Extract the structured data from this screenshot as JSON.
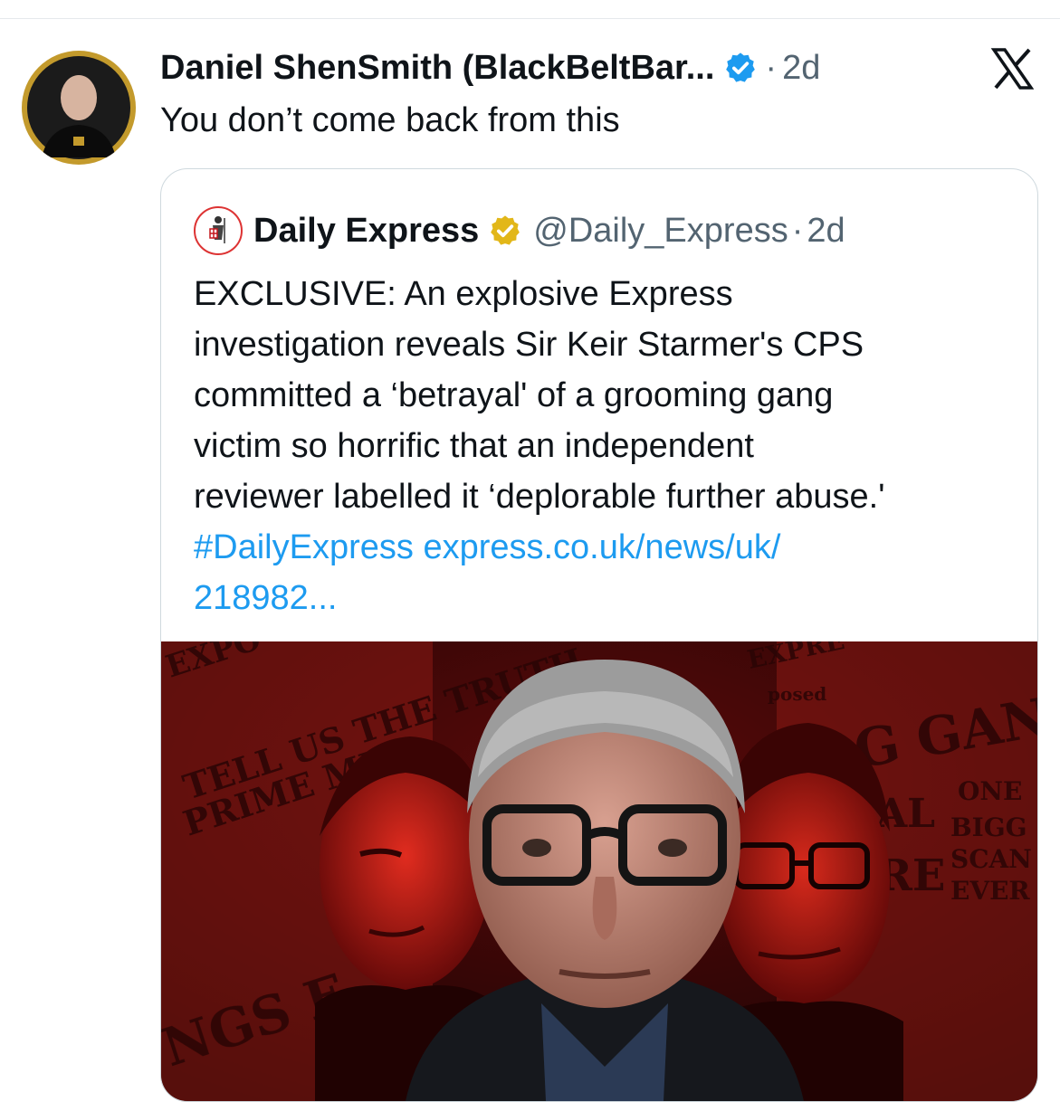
{
  "post": {
    "display_name": "Daniel ShenSmith (BlackBeltBar...",
    "separator": "·",
    "time": "2d",
    "text": "You don’t come back from this"
  },
  "quote": {
    "display_name": "Daily Express",
    "handle": "@Daily_Express",
    "separator": "·",
    "time": "2d",
    "body_lines": [
      "EXCLUSIVE: An explosive Express",
      "investigation reveals Sir Keir Starmer's CPS",
      "committed a ‘betrayal' of a grooming gang",
      "victim so horrific that an independent",
      "reviewer labelled it ‘deplorable further abuse.'"
    ],
    "hashtag": "#DailyExpress",
    "link_part1": "express.co.uk/news/uk/",
    "link_part2": "218982..."
  },
  "image_text": {
    "left_headline1": "TELL US THE TRUTH",
    "left_headline2": "PRIME MIN",
    "left_headline3": "NGS F",
    "top_left": "EXPO",
    "top_right": "EXPRE",
    "right_headline1": "G GANGS",
    "right_small1": "ONE",
    "right_small2": "BIGG",
    "right_small3": "SCAN",
    "right_small4": "EVER",
    "right_mid1": "AL",
    "right_mid2": "RE",
    "right_note": "posed"
  },
  "icons": {
    "verified_post": "verified-badge-blue-icon",
    "verified_quote": "verified-badge-gold-icon",
    "x_logo": "x-logo-icon"
  },
  "colors": {
    "link": "#1d9bf0",
    "secondary_text": "#536471",
    "verified_blue": "#1d9bf0",
    "verified_gold": "#e2b719",
    "image_red": "#c4161c"
  }
}
